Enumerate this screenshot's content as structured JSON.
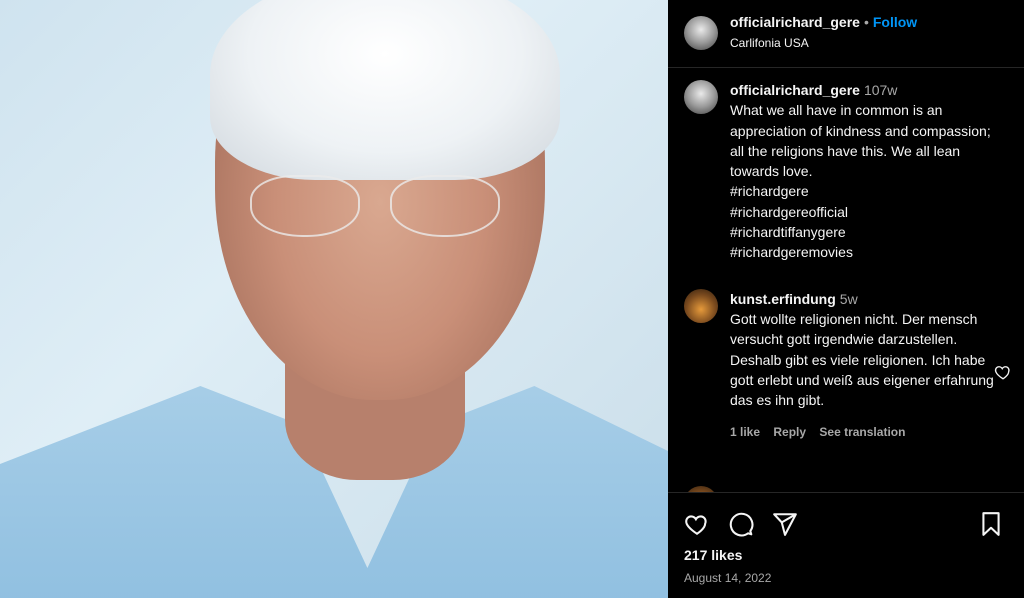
{
  "post": {
    "username": "officialrichard_gere",
    "follow_label": "Follow",
    "location": "Carlifonia USA",
    "likes": "217 likes",
    "date": "August 14, 2022"
  },
  "caption": {
    "username": "officialrichard_gere",
    "time": "107w",
    "text": "What we all have in common is an appreciation of kindness and compassion; all the religions have this. We all lean towards love.\n#richardgere\n#richardgereofficial\n#richardtiffanygere\n#richardgeremovies"
  },
  "comments": [
    {
      "username": "kunst.erfindung",
      "time": "5w",
      "text": "Gott wollte religionen nicht. Der mensch versucht gott irgendwie darzustellen. Deshalb gibt es viele religionen. Ich habe gott erlebt und weiß aus eigener erfahrung das es ihn gibt.",
      "likes_label": "1 like",
      "reply_label": "Reply",
      "translate_label": "See translation"
    }
  ],
  "icons": {
    "like": "heart-icon",
    "comment": "comment-icon",
    "share": "share-icon",
    "save": "bookmark-icon"
  },
  "colors": {
    "accent": "#0095f6",
    "background": "#000000",
    "muted": "#a8a8a8"
  }
}
